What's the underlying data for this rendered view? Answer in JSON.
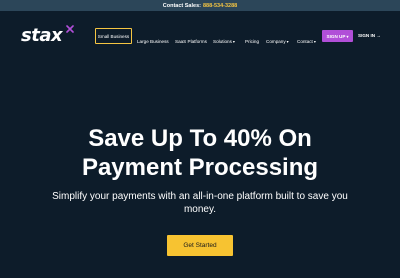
{
  "topbar": {
    "label": "Contact Sales:",
    "phone": "888-534-3288"
  },
  "brand": {
    "logo_text": "stax"
  },
  "nav": {
    "active_item": "Small Business",
    "items": [
      {
        "label": "Large Business",
        "has_dropdown": false
      },
      {
        "label": "SaaS Platforms",
        "has_dropdown": false
      },
      {
        "label": "Solutions",
        "has_dropdown": true
      },
      {
        "label": "Pricing",
        "has_dropdown": false
      },
      {
        "label": "Company",
        "has_dropdown": true
      },
      {
        "label": "Contact",
        "has_dropdown": true
      }
    ],
    "signup_label": "SIGN UP",
    "signin_label": "SIGN IN"
  },
  "hero": {
    "title_line1": "Save Up To 40% On",
    "title_line2": "Payment Processing",
    "subtitle": "Simplify your payments with an all-in-one platform built to save you money.",
    "cta_label": "Get Started"
  },
  "colors": {
    "background": "#0d1c2a",
    "topbar": "#2c4659",
    "accent_yellow": "#f7c331",
    "accent_purple": "#b14fd8"
  }
}
